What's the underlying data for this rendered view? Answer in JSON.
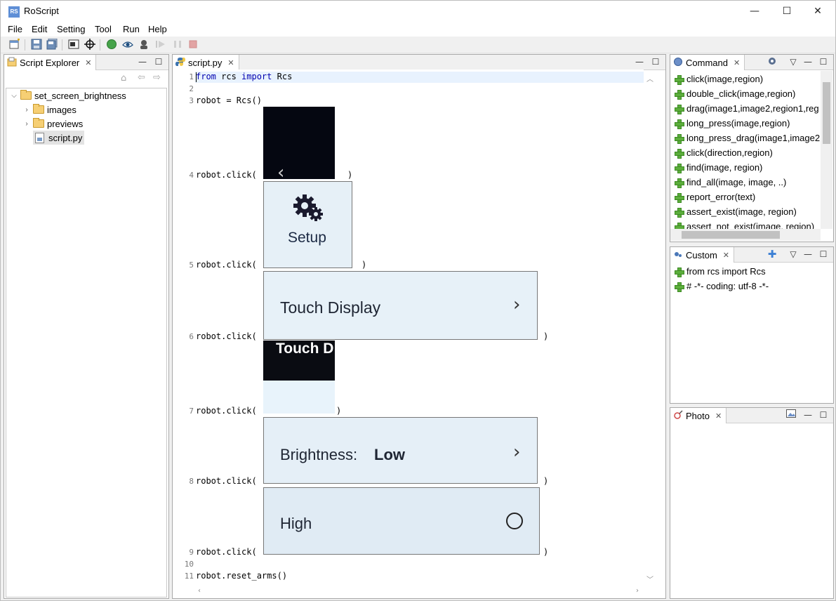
{
  "app": {
    "title": "RoScript",
    "logo_text": "RS"
  },
  "window_controls": {
    "minimize": "—",
    "maximize": "☐",
    "close": "✕"
  },
  "menu": [
    "File",
    "Edit",
    "Setting",
    "Tool",
    "Run",
    "Help"
  ],
  "explorer": {
    "tab_label": "Script Explorer",
    "tree": {
      "root": "set_screen_brightness",
      "children": [
        {
          "label": "images",
          "type": "folder"
        },
        {
          "label": "previews",
          "type": "folder"
        },
        {
          "label": "script.py",
          "type": "file",
          "selected": true
        }
      ]
    }
  },
  "editor": {
    "tab_label": "script.py",
    "lines": [
      {
        "n": "1",
        "code": "from rcs import Rcs"
      },
      {
        "n": "2",
        "code": ""
      },
      {
        "n": "3",
        "code": "robot = Rcs()"
      },
      {
        "n": "4",
        "code": "robot.click(",
        "tail": ")"
      },
      {
        "n": "5",
        "code": "robot.click(",
        "tail": ")"
      },
      {
        "n": "6",
        "code": "robot.click(",
        "tail": ")"
      },
      {
        "n": "7",
        "code": "robot.click(",
        "tail": ")"
      },
      {
        "n": "8",
        "code": "robot.click(",
        "tail": ")"
      },
      {
        "n": "9",
        "code": "robot.click(",
        "tail": ")"
      },
      {
        "n": "10",
        "code": ""
      },
      {
        "n": "11",
        "code": "robot.reset_arms()"
      }
    ],
    "keywords": {
      "from": "from",
      "import": "import",
      "module": " rcs ",
      "name": " Rcs"
    },
    "images": {
      "back_glyph": "‹",
      "setup_label": "Setup",
      "touch_display_label": "Touch Display",
      "touch_display_chevron": "›",
      "touch_d_label": "Touch D",
      "brightness_label": "Brightness:",
      "brightness_value": "Low",
      "brightness_chevron": "›",
      "high_label": "High"
    }
  },
  "command": {
    "tab_label": "Command",
    "items": [
      "click(image,region)",
      "double_click(image,region)",
      "drag(image1,image2,region1,reg",
      "long_press(image,region)",
      "long_press_drag(image1,image2",
      "click(direction,region)",
      "find(image, region)",
      "find_all(image, image, ..)",
      "report_error(text)",
      "assert_exist(image, region)",
      "assert_not_exist(image, region)"
    ]
  },
  "custom": {
    "tab_label": "Custom",
    "items": [
      "from rcs import Rcs",
      "# -*- coding: utf-8 -*-"
    ]
  },
  "photo": {
    "tab_label": "Photo"
  },
  "colors": {
    "accent": "#5cae3c",
    "selection": "#e8f2fe",
    "keyword": "#0000b0"
  }
}
